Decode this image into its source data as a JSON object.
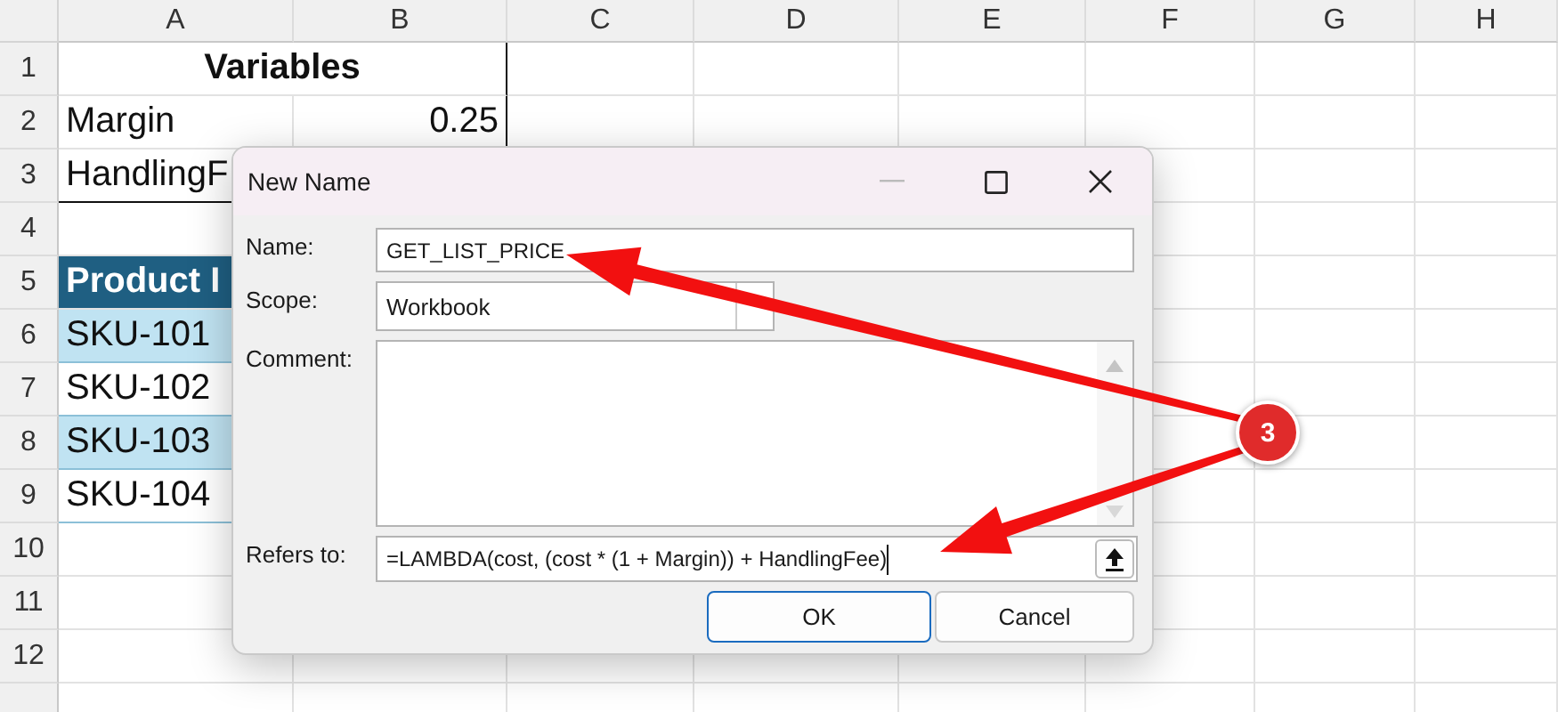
{
  "sheet": {
    "columns": [
      "A",
      "B",
      "C",
      "D",
      "E",
      "F",
      "G",
      "H"
    ],
    "rows": [
      {
        "number": "1",
        "cells": [
          {
            "text": "Variables",
            "kind": "title"
          }
        ]
      },
      {
        "number": "2",
        "cells": [
          {
            "text": "Margin",
            "kind": "label"
          },
          {
            "text": "0.25",
            "kind": "value"
          }
        ]
      },
      {
        "number": "3",
        "cells": [
          {
            "text": "HandlingF",
            "kind": "label-last"
          }
        ]
      },
      {
        "number": "4"
      },
      {
        "number": "5",
        "cells": [
          {
            "text": "Product I",
            "kind": "header"
          }
        ]
      },
      {
        "number": "6",
        "cells": [
          {
            "text": "SKU-101",
            "kind": "band"
          }
        ]
      },
      {
        "number": "7",
        "cells": [
          {
            "text": "SKU-102",
            "kind": "plain"
          }
        ]
      },
      {
        "number": "8",
        "cells": [
          {
            "text": "SKU-103",
            "kind": "band"
          }
        ]
      },
      {
        "number": "9",
        "cells": [
          {
            "text": "SKU-104",
            "kind": "plain"
          }
        ]
      },
      {
        "number": "10"
      },
      {
        "number": "11"
      },
      {
        "number": "12"
      }
    ]
  },
  "dialog": {
    "title": "New Name",
    "fields": [
      {
        "label": "Name:",
        "kind": "text",
        "value": "GET_LIST_PRICE"
      },
      {
        "label": "Scope:",
        "kind": "dropdown",
        "value": "Workbook"
      },
      {
        "label": "Comment:",
        "kind": "textarea"
      },
      {
        "label": "Refers to:",
        "kind": "reference",
        "value": "=LAMBDA(cost, (cost * (1 + Margin)) + HandlingFee)"
      }
    ],
    "buttons": [
      {
        "label": "OK",
        "default": true
      },
      {
        "label": "Cancel",
        "default": false
      }
    ]
  },
  "callout": {
    "number": "3"
  }
}
